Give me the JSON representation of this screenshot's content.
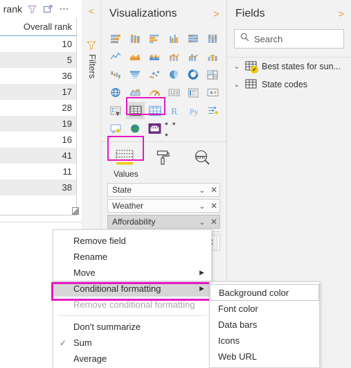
{
  "canvas": {
    "visual_title": "Overall rank",
    "header_icons": [
      {
        "name": "filter-icon",
        "label": "Filter"
      },
      {
        "name": "focus-mode-icon",
        "label": "Focus mode"
      },
      {
        "name": "more-options-icon",
        "label": "More options"
      }
    ],
    "table": {
      "column_header": "Overall rank",
      "values": [
        "10",
        "5",
        "36",
        "17",
        "28",
        "19",
        "16",
        "41",
        "11",
        "38"
      ]
    }
  },
  "filters_rail": {
    "collapse_label": "<",
    "icon": "funnel-icon",
    "label": "Filters"
  },
  "visualizations": {
    "title": "Visualizations",
    "expand_label": ">",
    "icons": [
      "stacked-bar-chart-icon",
      "stacked-column-chart-icon",
      "clustered-bar-chart-icon",
      "clustered-column-chart-icon",
      "hundred-percent-stacked-bar-icon",
      "hundred-percent-stacked-column-icon",
      "line-chart-icon",
      "area-chart-icon",
      "stacked-area-chart-icon",
      "line-stacked-column-icon",
      "line-clustered-column-icon",
      "ribbon-chart-icon",
      "waterfall-chart-icon",
      "funnel-chart-icon",
      "scatter-chart-icon",
      "pie-chart-icon",
      "donut-chart-icon",
      "treemap-icon",
      "map-icon",
      "filled-map-icon",
      "gauge-icon",
      "card-icon",
      "multi-row-card-icon",
      "kpi-icon",
      "slicer-icon",
      "table-icon",
      "matrix-icon",
      "r-script-visual-icon",
      "python-visual-icon",
      "key-influencers-icon",
      "qna-visual-icon",
      "arcgis-map-icon",
      "paginated-report-icon",
      "more-visuals-icon"
    ],
    "selected_icon": "table-icon",
    "highlighted_icons": [
      "table-icon",
      "matrix-icon"
    ],
    "tabs": [
      {
        "name": "fields-tab",
        "icon": "fields-icon",
        "label": "Values",
        "selected": true
      },
      {
        "name": "format-tab",
        "icon": "paint-roller-icon",
        "label": "",
        "selected": false
      },
      {
        "name": "analytics-tab",
        "icon": "magnifier-icon",
        "label": "",
        "selected": false
      }
    ],
    "well_label": "Values",
    "wells": [
      {
        "name": "State",
        "active": false
      },
      {
        "name": "Weather",
        "active": false
      },
      {
        "name": "Affordability",
        "active": true
      }
    ]
  },
  "fields": {
    "title": "Fields",
    "expand_label": ">",
    "search": {
      "placeholder": "Search",
      "value": "",
      "icon": "search-icon"
    },
    "tables": [
      {
        "label": "Best states for sun...",
        "icon": "table-field-icon",
        "badge": "✔",
        "expander": "chevron-down-icon"
      },
      {
        "label": "State codes",
        "icon": "table-field-icon",
        "badge": "",
        "expander": "chevron-down-icon"
      }
    ]
  },
  "context_menu": {
    "items": [
      {
        "label": "Remove field",
        "submenu": false,
        "checked": false,
        "disabled": false,
        "highlighted": false
      },
      {
        "label": "Rename",
        "submenu": false,
        "checked": false,
        "disabled": false,
        "highlighted": false
      },
      {
        "label": "Move",
        "submenu": true,
        "checked": false,
        "disabled": false,
        "highlighted": false
      },
      {
        "label": "Conditional formatting",
        "submenu": true,
        "checked": false,
        "disabled": false,
        "highlighted": true
      },
      {
        "label": "Remove conditional formatting",
        "submenu": false,
        "checked": false,
        "disabled": true,
        "highlighted": false
      },
      {
        "label": "Don't summarize",
        "submenu": false,
        "checked": false,
        "disabled": false,
        "highlighted": false
      },
      {
        "label": "Sum",
        "submenu": false,
        "checked": true,
        "disabled": false,
        "highlighted": false
      },
      {
        "label": "Average",
        "submenu": false,
        "checked": false,
        "disabled": false,
        "highlighted": false
      }
    ],
    "arrow_glyph": "▶",
    "check_glyph": "✓"
  },
  "submenu": {
    "items": [
      {
        "label": "Background color",
        "hover": true
      },
      {
        "label": "Font color",
        "hover": false
      },
      {
        "label": "Data bars",
        "hover": false
      },
      {
        "label": "Icons",
        "hover": false
      },
      {
        "label": "Web URL",
        "hover": false
      }
    ]
  },
  "colors": {
    "highlight_magenta": "#e619c3",
    "accent_orange": "#e8a33d",
    "pane_background": "#f2f2f2",
    "badge_yellow": "#f2c811",
    "header_underline_blue": "#6ca8d8"
  }
}
